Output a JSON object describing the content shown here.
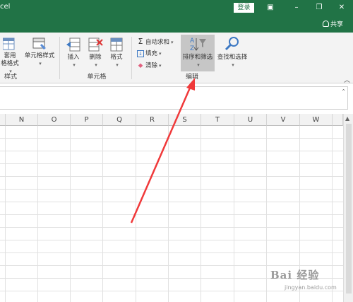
{
  "titlebar": {
    "title_fragment": "cel",
    "login_label": "登录",
    "share_label": "共享"
  },
  "ribbon": {
    "styles_group": {
      "format_table_line1": "套用",
      "format_table_line2": "格格式",
      "cell_styles_label": "单元格样式",
      "group_label": "样式"
    },
    "cells_group": {
      "insert_label": "插入",
      "delete_label": "删除",
      "format_label": "格式",
      "group_label": "单元格"
    },
    "editing_group": {
      "autosum_label": "自动求和",
      "fill_label": "填充",
      "clear_label": "清除",
      "sort_filter_label": "排序和筛选",
      "find_select_label": "查找和选择",
      "group_label": "编辑"
    }
  },
  "grid": {
    "columns": [
      "N",
      "O",
      "P",
      "Q",
      "R",
      "S",
      "T",
      "U",
      "V",
      "W"
    ]
  },
  "watermark": {
    "brand": "Bai 经验",
    "url": "jingyan.baidu.com"
  },
  "colors": {
    "excel_green": "#217346",
    "arrow_red": "#f0393a",
    "sort_highlight": "#c6c6c6"
  }
}
